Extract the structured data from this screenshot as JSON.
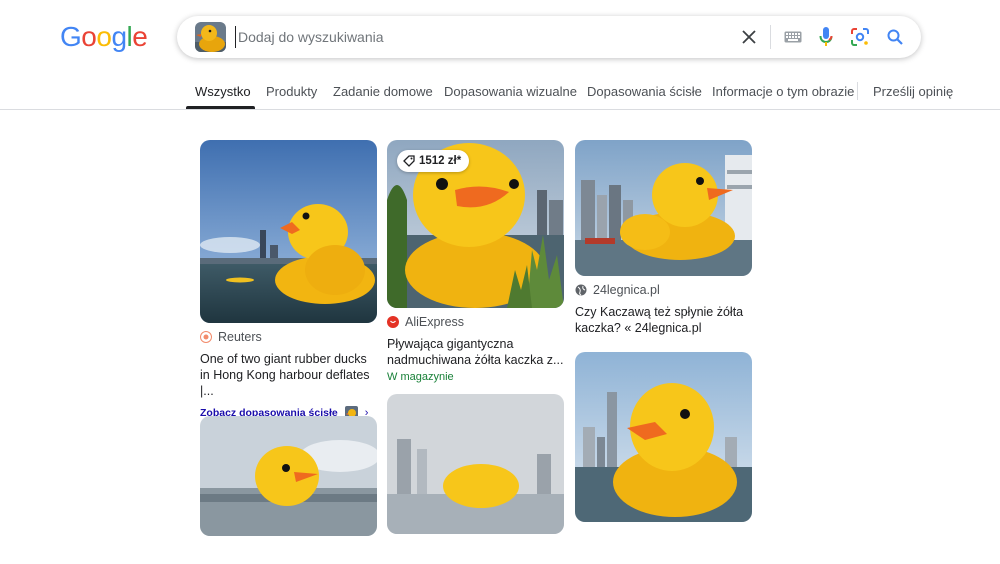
{
  "logo": {
    "letters": [
      {
        "char": "G",
        "color": "#4285F4"
      },
      {
        "char": "o",
        "color": "#EA4335"
      },
      {
        "char": "o",
        "color": "#FBBC05"
      },
      {
        "char": "g",
        "color": "#4285F4"
      },
      {
        "char": "l",
        "color": "#34A853"
      },
      {
        "char": "e",
        "color": "#EA4335"
      }
    ]
  },
  "search": {
    "placeholder": "Dodaj do wyszukiwania",
    "value": ""
  },
  "search_icons": [
    "close-icon",
    "keyboard-icon",
    "microphone-icon",
    "lens-icon",
    "search-icon"
  ],
  "tabs": [
    {
      "label": "Wszystko",
      "active": true
    },
    {
      "label": "Produkty"
    },
    {
      "label": "Zadanie domowe"
    },
    {
      "label": "Dopasowania wizualne"
    },
    {
      "label": "Dopasowania ścisłe"
    },
    {
      "label": "Informacje o tym obrazie"
    },
    {
      "label": "Prześlij opinię"
    }
  ],
  "results": [
    {
      "source": "Reuters",
      "title": "One of two giant rubber ducks in Hong Kong harbour deflates |...",
      "exact_matches_label": "Zobacz dopasowania ścisłe",
      "favicon_color": "#f28b6b"
    },
    {
      "source": "AliExpress",
      "title": "Pływająca gigantyczna nadmuchiwana żółta kaczka z...",
      "price": "1512 zł*",
      "stock": "W magazynie",
      "favicon_color": "#e43225"
    },
    {
      "source": "24legnica.pl",
      "title": "Czy Kaczawą też spłynie żółta kaczka? « 24legnica.pl",
      "favicon_color": "#5f6368"
    },
    {
      "source": "",
      "title": ""
    },
    {
      "source": "",
      "title": ""
    },
    {
      "source": "",
      "title": ""
    }
  ],
  "colors": {
    "accent_blue": "#1a73e8",
    "link": "#1a0dab",
    "stock_green": "#188038",
    "duck_yellow": "#f7c61a",
    "beak_orange": "#ef6a1f"
  }
}
